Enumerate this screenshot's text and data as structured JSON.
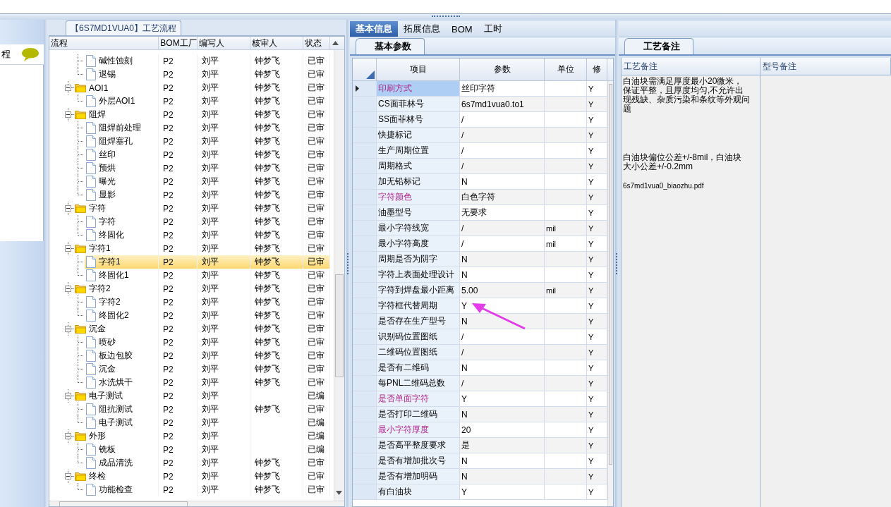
{
  "left_strip": {
    "label": "程"
  },
  "flow_panel": {
    "title": "【6S7MD1VUA0】工艺流程",
    "columns": [
      "流程",
      "BOM工厂",
      "编写人",
      "核审人",
      "状态"
    ],
    "rows": [
      {
        "children": [
          {
            "label": "碱性蚀刻",
            "bom": "P2",
            "author": "刘平",
            "reviewer": "钟梦飞",
            "status": "已审",
            "selected": false
          },
          {
            "label": "退锡",
            "bom": "P2",
            "author": "刘平",
            "reviewer": "钟梦飞",
            "status": "已审",
            "selected": false
          }
        ]
      },
      {
        "label": "AOI1",
        "bom": "P2",
        "author": "刘平",
        "reviewer": "钟梦飞",
        "status": "已审",
        "selected": false,
        "expanded": true,
        "children": [
          {
            "label": "外层AOI1",
            "bom": "P2",
            "author": "刘平",
            "reviewer": "钟梦飞",
            "status": "已审",
            "selected": false
          }
        ]
      },
      {
        "label": "阻焊",
        "bom": "P2",
        "author": "刘平",
        "reviewer": "钟梦飞",
        "status": "已审",
        "selected": false,
        "expanded": true,
        "children": [
          {
            "label": "阻焊前处理",
            "bom": "P2",
            "author": "刘平",
            "reviewer": "钟梦飞",
            "status": "已审",
            "selected": false
          },
          {
            "label": "阻焊塞孔",
            "bom": "P2",
            "author": "刘平",
            "reviewer": "钟梦飞",
            "status": "已审",
            "selected": false
          },
          {
            "label": "丝印",
            "bom": "P2",
            "author": "刘平",
            "reviewer": "钟梦飞",
            "status": "已审",
            "selected": false
          },
          {
            "label": "预烘",
            "bom": "P2",
            "author": "刘平",
            "reviewer": "钟梦飞",
            "status": "已审",
            "selected": false
          },
          {
            "label": "曝光",
            "bom": "P2",
            "author": "刘平",
            "reviewer": "钟梦飞",
            "status": "已审",
            "selected": false
          },
          {
            "label": "显影",
            "bom": "P2",
            "author": "刘平",
            "reviewer": "钟梦飞",
            "status": "已审",
            "selected": false
          }
        ]
      },
      {
        "label": "字符",
        "bom": "P2",
        "author": "刘平",
        "reviewer": "钟梦飞",
        "status": "已审",
        "selected": false,
        "expanded": true,
        "children": [
          {
            "label": "字符",
            "bom": "P2",
            "author": "刘平",
            "reviewer": "钟梦飞",
            "status": "已审",
            "selected": false
          },
          {
            "label": "终固化",
            "bom": "P2",
            "author": "刘平",
            "reviewer": "钟梦飞",
            "status": "已审",
            "selected": false
          }
        ]
      },
      {
        "label": "字符1",
        "bom": "P2",
        "author": "刘平",
        "reviewer": "钟梦飞",
        "status": "已审",
        "selected": false,
        "expanded": true,
        "children": [
          {
            "label": "字符1",
            "bom": "P2",
            "author": "刘平",
            "reviewer": "钟梦飞",
            "status": "已审",
            "selected": true
          },
          {
            "label": "终固化1",
            "bom": "P2",
            "author": "刘平",
            "reviewer": "钟梦飞",
            "status": "已审",
            "selected": false
          }
        ]
      },
      {
        "label": "字符2",
        "bom": "P2",
        "author": "刘平",
        "reviewer": "钟梦飞",
        "status": "已审",
        "selected": false,
        "expanded": true,
        "children": [
          {
            "label": "字符2",
            "bom": "P2",
            "author": "刘平",
            "reviewer": "钟梦飞",
            "status": "已审",
            "selected": false
          },
          {
            "label": "终固化2",
            "bom": "P2",
            "author": "刘平",
            "reviewer": "钟梦飞",
            "status": "已审",
            "selected": false
          }
        ]
      },
      {
        "label": "沉金",
        "bom": "P2",
        "author": "刘平",
        "reviewer": "钟梦飞",
        "status": "已审",
        "selected": false,
        "expanded": true,
        "children": [
          {
            "label": "喷砂",
            "bom": "P2",
            "author": "刘平",
            "reviewer": "钟梦飞",
            "status": "已审",
            "selected": false
          },
          {
            "label": "板边包胶",
            "bom": "P2",
            "author": "刘平",
            "reviewer": "钟梦飞",
            "status": "已审",
            "selected": false
          },
          {
            "label": "沉金",
            "bom": "P2",
            "author": "刘平",
            "reviewer": "钟梦飞",
            "status": "已审",
            "selected": false
          },
          {
            "label": "水洗烘干",
            "bom": "P2",
            "author": "刘平",
            "reviewer": "钟梦飞",
            "status": "已审",
            "selected": false
          }
        ]
      },
      {
        "label": "电子测试",
        "bom": "P2",
        "author": "刘平",
        "status": "已编",
        "selected": false,
        "expanded": true,
        "children": [
          {
            "label": "阻抗测试",
            "bom": "P2",
            "author": "刘平",
            "reviewer": "钟梦飞",
            "status": "已审",
            "selected": false
          },
          {
            "label": "电子测试",
            "bom": "P2",
            "author": "刘平",
            "status": "已编",
            "selected": false
          }
        ]
      },
      {
        "label": "外形",
        "bom": "P2",
        "author": "刘平",
        "status": "已编",
        "selected": false,
        "expanded": true,
        "children": [
          {
            "label": "铣板",
            "bom": "P2",
            "author": "刘平",
            "status": "已编",
            "selected": false
          },
          {
            "label": "成品清洗",
            "bom": "P2",
            "author": "刘平",
            "reviewer": "钟梦飞",
            "status": "已审",
            "selected": false
          }
        ]
      },
      {
        "label": "终检",
        "bom": "P2",
        "author": "刘平",
        "reviewer": "钟梦飞",
        "status": "已审",
        "selected": false,
        "expanded": true,
        "children": [
          {
            "label": "功能检查",
            "bom": "P2",
            "author": "刘平",
            "reviewer": "钟梦飞",
            "status": "已审",
            "selected": false
          }
        ]
      }
    ]
  },
  "detail": {
    "tabs": [
      {
        "label": "基本信息",
        "selected": true
      },
      {
        "label": "拓展信息",
        "selected": false
      },
      {
        "label": "BOM",
        "selected": false
      },
      {
        "label": "工时",
        "selected": false
      }
    ],
    "subtab": "基本参数",
    "columns": [
      "项目",
      "参数",
      "单位",
      "修"
    ],
    "rows": [
      {
        "item": "印刷方式",
        "value": "丝印字符",
        "flag": "Y",
        "highlight": true,
        "selected": true
      },
      {
        "item": "CS面菲林号",
        "value": "6s7md1vua0.to1",
        "flag": "Y",
        "highlight": false,
        "selected": false
      },
      {
        "item": "SS面菲林号",
        "value": "/",
        "flag": "Y",
        "highlight": false,
        "selected": false
      },
      {
        "item": "快捷标记",
        "value": "/",
        "flag": "Y",
        "highlight": false,
        "selected": false
      },
      {
        "item": "生产周期位置",
        "value": "/",
        "flag": "Y",
        "highlight": false,
        "selected": false
      },
      {
        "item": "周期格式",
        "value": "/",
        "flag": "Y",
        "highlight": false,
        "selected": false
      },
      {
        "item": "加无铅标记",
        "value": "N",
        "flag": "Y",
        "highlight": false,
        "selected": false
      },
      {
        "item": "字符颜色",
        "value": "白色字符",
        "flag": "Y",
        "highlight": true,
        "selected": false
      },
      {
        "item": "油墨型号",
        "value": "无要求",
        "flag": "Y",
        "highlight": false,
        "selected": false
      },
      {
        "item": "最小字符线宽",
        "value": "/",
        "unit": "mil",
        "flag": "Y",
        "highlight": false,
        "selected": false
      },
      {
        "item": "最小字符高度",
        "value": "/",
        "unit": "mil",
        "flag": "Y",
        "highlight": false,
        "selected": false
      },
      {
        "item": "周期是否为阴字",
        "value": "N",
        "flag": "Y",
        "highlight": false,
        "selected": false
      },
      {
        "item": "字符上表面处理设计",
        "value": "N",
        "flag": "Y",
        "highlight": false,
        "selected": false
      },
      {
        "item": "字符到焊盘最小距离",
        "value": "5.00",
        "unit": "mil",
        "flag": "Y",
        "highlight": false,
        "selected": false
      },
      {
        "item": "字符框代替周期",
        "value": "Y",
        "flag": "Y",
        "highlight": false,
        "selected": false
      },
      {
        "item": "是否存在生产型号",
        "value": "N",
        "flag": "Y",
        "highlight": false,
        "selected": false
      },
      {
        "item": "识别码位置图纸",
        "value": "/",
        "flag": "Y",
        "highlight": false,
        "selected": false
      },
      {
        "item": "二维码位置图纸",
        "value": "/",
        "flag": "Y",
        "highlight": false,
        "selected": false
      },
      {
        "item": "是否有二维码",
        "value": "N",
        "flag": "Y",
        "highlight": false,
        "selected": false
      },
      {
        "item": "每PNL二维码总数",
        "value": "/",
        "flag": "Y",
        "highlight": false,
        "selected": false
      },
      {
        "item": "是否单面字符",
        "value": "Y",
        "flag": "Y",
        "highlight": true,
        "selected": false
      },
      {
        "item": "是否打印二维码",
        "value": "N",
        "flag": "Y",
        "highlight": false,
        "selected": false
      },
      {
        "item": "最小字符厚度",
        "value": "20",
        "flag": "Y",
        "highlight": true,
        "selected": false
      },
      {
        "item": "是否高平整度要求",
        "value": "是",
        "flag": "Y",
        "highlight": false,
        "selected": false
      },
      {
        "item": "是否有增加批次号",
        "value": "N",
        "flag": "Y",
        "highlight": false,
        "selected": false
      },
      {
        "item": "是否有增加明码",
        "value": "N",
        "flag": "Y",
        "highlight": false,
        "selected": false
      },
      {
        "item": "有白油块",
        "value": "Y",
        "flag": "Y",
        "highlight": false,
        "selected": false
      }
    ]
  },
  "notes": {
    "subtab": "工艺备注",
    "columns": [
      "工艺备注",
      "型号备注"
    ],
    "texts": [
      "白油块需满足厚度最小20微米，保证平整，且厚度均匀,不允许出现残缺、杂质污染和条纹等外观问题",
      "白油块偏位公差+/-8mil，白油块大小公差+/-0.2mm",
      "6s7md1vua0_biaozhu.pdf"
    ]
  }
}
